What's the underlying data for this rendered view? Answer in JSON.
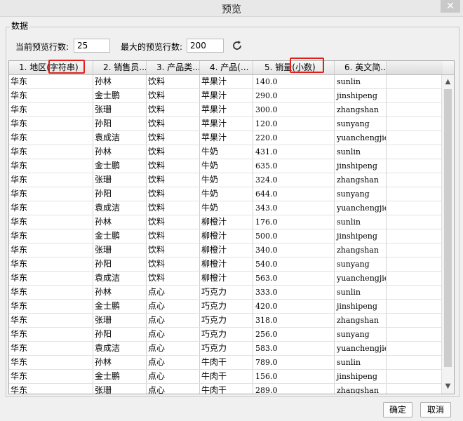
{
  "window": {
    "title": "预览",
    "close_label": "✕"
  },
  "group": {
    "legend": "数据"
  },
  "controls": {
    "current_rows_label": "当前预览行数:",
    "current_rows_value": "25",
    "max_rows_label": "最大的预览行数:",
    "max_rows_value": "200",
    "refresh_icon": "refresh-icon"
  },
  "table": {
    "headers": [
      "1. 地区(字符串)",
      "2. 销售员...",
      "3. 产品类...",
      "4. 产品(...",
      "5. 销量(小数)",
      "6. 英文简..."
    ],
    "rows": [
      [
        "华东",
        "孙林",
        "饮料",
        "苹果汁",
        "140.0",
        "sunlin"
      ],
      [
        "华东",
        "金士鹏",
        "饮料",
        "苹果汁",
        "290.0",
        "jinshipeng"
      ],
      [
        "华东",
        "张珊",
        "饮料",
        "苹果汁",
        "300.0",
        "zhangshan"
      ],
      [
        "华东",
        "孙阳",
        "饮料",
        "苹果汁",
        "120.0",
        "sunyang"
      ],
      [
        "华东",
        "袁成洁",
        "饮料",
        "苹果汁",
        "220.0",
        "yuanchengjie"
      ],
      [
        "华东",
        "孙林",
        "饮料",
        "牛奶",
        "431.0",
        "sunlin"
      ],
      [
        "华东",
        "金士鹏",
        "饮料",
        "牛奶",
        "635.0",
        "jinshipeng"
      ],
      [
        "华东",
        "张珊",
        "饮料",
        "牛奶",
        "324.0",
        "zhangshan"
      ],
      [
        "华东",
        "孙阳",
        "饮料",
        "牛奶",
        "644.0",
        "sunyang"
      ],
      [
        "华东",
        "袁成洁",
        "饮料",
        "牛奶",
        "343.0",
        "yuanchengjie"
      ],
      [
        "华东",
        "孙林",
        "饮料",
        "柳橙汁",
        "176.0",
        "sunlin"
      ],
      [
        "华东",
        "金士鹏",
        "饮料",
        "柳橙汁",
        "500.0",
        "jinshipeng"
      ],
      [
        "华东",
        "张珊",
        "饮料",
        "柳橙汁",
        "340.0",
        "zhangshan"
      ],
      [
        "华东",
        "孙阳",
        "饮料",
        "柳橙汁",
        "540.0",
        "sunyang"
      ],
      [
        "华东",
        "袁成洁",
        "饮料",
        "柳橙汁",
        "563.0",
        "yuanchengjie"
      ],
      [
        "华东",
        "孙林",
        "点心",
        "巧克力",
        "333.0",
        "sunlin"
      ],
      [
        "华东",
        "金士鹏",
        "点心",
        "巧克力",
        "420.0",
        "jinshipeng"
      ],
      [
        "华东",
        "张珊",
        "点心",
        "巧克力",
        "318.0",
        "zhangshan"
      ],
      [
        "华东",
        "孙阳",
        "点心",
        "巧克力",
        "256.0",
        "sunyang"
      ],
      [
        "华东",
        "袁成洁",
        "点心",
        "巧克力",
        "583.0",
        "yuanchengjie"
      ],
      [
        "华东",
        "孙林",
        "点心",
        "牛肉干",
        "789.0",
        "sunlin"
      ],
      [
        "华东",
        "金士鹏",
        "点心",
        "牛肉干",
        "156.0",
        "jinshipeng"
      ],
      [
        "华东",
        "张珊",
        "点心",
        "牛肉干",
        "289.0",
        "zhangshan"
      ]
    ]
  },
  "buttons": {
    "ok": "确定",
    "cancel": "取消"
  },
  "colors": {
    "highlight": "#e0201b"
  }
}
